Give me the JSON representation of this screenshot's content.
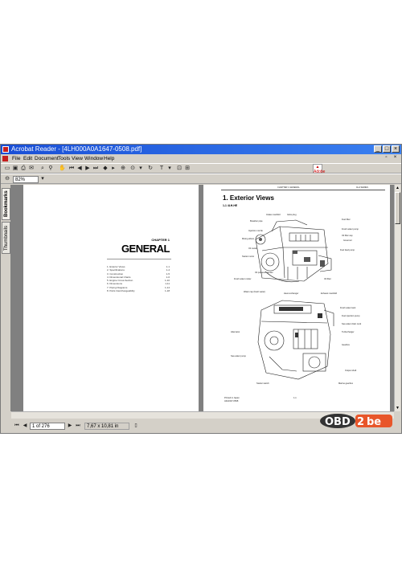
{
  "window": {
    "title": "Acrobat Reader - [4LH000A0A1647-0508.pdf]"
  },
  "menu": [
    "File",
    "Edit",
    "Document",
    "Tools",
    "View",
    "Window",
    "Help"
  ],
  "toolbar": {
    "zoom_value": "82%"
  },
  "side_tabs": {
    "bookmarks": "Bookmarks",
    "thumbnails": "Thumbnails"
  },
  "left_page": {
    "chapter": "CHAPTER 1",
    "title": "GENERAL",
    "toc": [
      {
        "label": "1. Exterior Views",
        "page": "1-1"
      },
      {
        "label": "2. Specifications",
        "page": "1-4"
      },
      {
        "label": "3. Construction",
        "page": "1-5"
      },
      {
        "label": "4. Dimensional Charts",
        "page": "1-6"
      },
      {
        "label": "5. Engine Cross-Section",
        "page": "1-10"
      },
      {
        "label": "6. Dimensions",
        "page": "1-11"
      },
      {
        "label": "7. Piping Diagrams",
        "page": "1-14"
      },
      {
        "label": "8. Parts Interchangeability",
        "page": "1-18"
      }
    ]
  },
  "right_page": {
    "header_left": "CHAPTER 1 GENERAL",
    "header_right": "4LH  SERIES",
    "title": "1. Exterior Views",
    "subtitle": "1-1 4LH-HE",
    "labels_top": [
      "Intake manifold",
      "Glow plug",
      "Breather pipe",
      "Fuel filter",
      "Injection nozzle",
      "Mixing elbow",
      "Oil cooler",
      "Fresh water pump",
      "Oil pressure sender",
      "Fuel feed pump",
      "Oil filter",
      "Starter motor",
      "Governor",
      "Fresh water cooler",
      "Oil filler cap"
    ],
    "labels_bottom": [
      "Water cap (fresh water)",
      "Heat exchanger",
      "Exhaust manifold",
      "Fuel injection pump",
      "Alternator",
      "Sea water pump",
      "Sea water drain cock",
      "Turbocharger",
      "Fresh water tank",
      "Gearbox",
      "Starter switch",
      "Output shaft",
      "Marine gearbox"
    ],
    "footer_left": "Printed in Japan",
    "footer_code": "A0A1647-0508",
    "footer_page": "1-1"
  },
  "status": {
    "page_info": "1 of 276",
    "page_size": "7,67 x 10,81 in"
  },
  "logo": {
    "text_main": "OBD",
    "text_num": "2",
    "text_suffix": "be"
  },
  "colors": {
    "title_bar": "#1a4fd6",
    "chrome": "#d4d0c8",
    "doc_bg": "#808080",
    "logo_orange": "#e8562a"
  }
}
